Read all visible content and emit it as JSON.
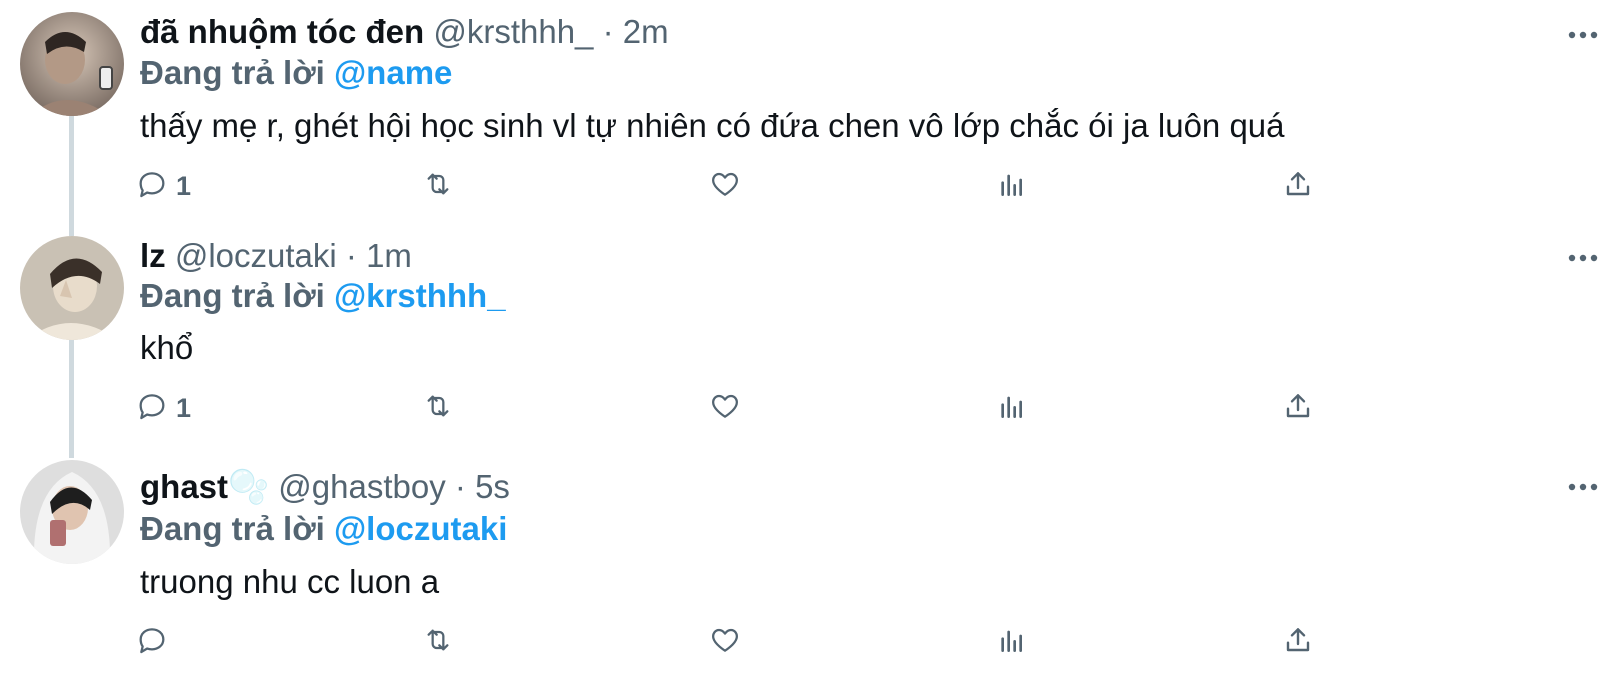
{
  "tweets": [
    {
      "name": "đã nhuộm tóc đen",
      "handle": "@krsthhh_",
      "time": "2m",
      "replying_prefix": "Đang trả lời",
      "replying_to": "@name",
      "text": "thấy mẹ r, ghét hội học sinh vl tự nhiên có đứa chen vô lớp chắc ói ja luôn quá",
      "reply_count": "1",
      "avatar_colors": [
        "#9a8a80",
        "#c6b5a6",
        "#5a4d45"
      ]
    },
    {
      "name": "lz",
      "handle": "@loczutaki",
      "time": "1m",
      "replying_prefix": "Đang trả lời",
      "replying_to": "@krsthhh_",
      "text": "khổ",
      "reply_count": "1",
      "avatar_colors": [
        "#b9b0a3",
        "#e2d9cc",
        "#4c4136"
      ]
    },
    {
      "name": "ghast",
      "name_emoji": "🫧",
      "handle": "@ghastboy",
      "time": "5s",
      "replying_prefix": "Đang trả lời",
      "replying_to": "@loczutaki",
      "text": "truong nhu cc luon a",
      "reply_count": "",
      "avatar_colors": [
        "#d9d9d9",
        "#f2f2f2",
        "#1e1e1e"
      ]
    }
  ],
  "separator": "·",
  "icons": [
    "reply-icon",
    "retweet-icon",
    "like-icon",
    "views-icon",
    "share-icon",
    "more-icon"
  ],
  "colors": {
    "accent": "#1d9bf0",
    "secondary": "#536471",
    "text": "#0f1419",
    "thread_line": "#cfd9de"
  }
}
